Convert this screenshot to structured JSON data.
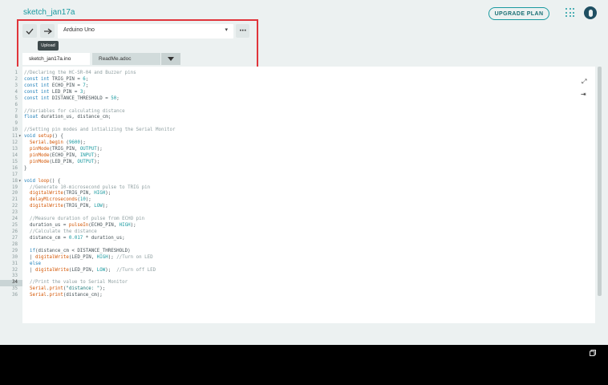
{
  "header": {
    "sketch_title": "sketch_jan17a",
    "upgrade_label": "UPGRADE PLAN"
  },
  "toolbar": {
    "board_label": "Arduino Uno",
    "tooltip": "Upload"
  },
  "tabs": [
    {
      "label": "sketch_jan17a.ino"
    },
    {
      "label": "ReadMe.adoc"
    }
  ],
  "editor": {
    "active_line": 34,
    "lines": [
      {
        "n": "1",
        "fold": "",
        "segs": [
          [
            "c",
            "//Declaring the HC-SR-04 and Buzzer pins"
          ]
        ]
      },
      {
        "n": "2",
        "fold": "",
        "segs": [
          [
            "k",
            "const int "
          ],
          [
            "p",
            "TRIG_PIN = "
          ],
          [
            "n",
            "6"
          ],
          [
            "p",
            ";"
          ]
        ]
      },
      {
        "n": "3",
        "fold": "",
        "segs": [
          [
            "k",
            "const int "
          ],
          [
            "p",
            "ECHO_PIN = "
          ],
          [
            "n",
            "7"
          ],
          [
            "p",
            ";"
          ]
        ]
      },
      {
        "n": "4",
        "fold": "",
        "segs": [
          [
            "k",
            "const int "
          ],
          [
            "p",
            "LED_PIN = "
          ],
          [
            "n",
            "3"
          ],
          [
            "p",
            ";"
          ]
        ]
      },
      {
        "n": "5",
        "fold": "",
        "segs": [
          [
            "k",
            "const int "
          ],
          [
            "p",
            "DISTANCE_THRESHOLD = "
          ],
          [
            "n",
            "50"
          ],
          [
            "p",
            ";"
          ]
        ]
      },
      {
        "n": "6",
        "fold": "",
        "segs": []
      },
      {
        "n": "7",
        "fold": "",
        "segs": [
          [
            "c",
            "//Variables for calculating distance"
          ]
        ]
      },
      {
        "n": "8",
        "fold": "",
        "segs": [
          [
            "k",
            "float "
          ],
          [
            "p",
            "duration_us, distance_cm;"
          ]
        ]
      },
      {
        "n": "9",
        "fold": "",
        "segs": []
      },
      {
        "n": "10",
        "fold": "",
        "segs": [
          [
            "c",
            "//Setting pin modes and intializing the Serial Monitor"
          ]
        ]
      },
      {
        "n": "11",
        "fold": "▾",
        "segs": [
          [
            "k",
            "void "
          ],
          [
            "f",
            "setup"
          ],
          [
            "p",
            "() {"
          ]
        ]
      },
      {
        "n": "12",
        "fold": "",
        "segs": [
          [
            "p",
            "  "
          ],
          [
            "f",
            "Serial"
          ],
          [
            "p",
            "."
          ],
          [
            "f",
            "begin"
          ],
          [
            "p",
            " ("
          ],
          [
            "n",
            "9600"
          ],
          [
            "p",
            ");"
          ]
        ]
      },
      {
        "n": "13",
        "fold": "",
        "segs": [
          [
            "p",
            "  "
          ],
          [
            "f",
            "pinMode"
          ],
          [
            "p",
            "(TRIG_PIN, "
          ],
          [
            "n",
            "OUTPUT"
          ],
          [
            "p",
            ");"
          ]
        ]
      },
      {
        "n": "14",
        "fold": "",
        "segs": [
          [
            "p",
            "  "
          ],
          [
            "f",
            "pinMode"
          ],
          [
            "p",
            "(ECHO_PIN, "
          ],
          [
            "n",
            "INPUT"
          ],
          [
            "p",
            ");"
          ]
        ]
      },
      {
        "n": "15",
        "fold": "",
        "segs": [
          [
            "p",
            "  "
          ],
          [
            "f",
            "pinMode"
          ],
          [
            "p",
            "(LED_PIN, "
          ],
          [
            "n",
            "OUTPUT"
          ],
          [
            "p",
            ");"
          ]
        ]
      },
      {
        "n": "16",
        "fold": "",
        "segs": [
          [
            "p",
            "}"
          ]
        ]
      },
      {
        "n": "17",
        "fold": "",
        "segs": []
      },
      {
        "n": "18",
        "fold": "▾",
        "segs": [
          [
            "k",
            "void "
          ],
          [
            "f",
            "loop"
          ],
          [
            "p",
            "() {"
          ]
        ]
      },
      {
        "n": "19",
        "fold": "",
        "segs": [
          [
            "p",
            "  "
          ],
          [
            "c",
            "//Generate 10-microsecond pulse to TRIG pin"
          ]
        ]
      },
      {
        "n": "20",
        "fold": "",
        "segs": [
          [
            "p",
            "  "
          ],
          [
            "f",
            "digitalWrite"
          ],
          [
            "p",
            "(TRIG_PIN, "
          ],
          [
            "n",
            "HIGH"
          ],
          [
            "p",
            ");"
          ]
        ]
      },
      {
        "n": "21",
        "fold": "",
        "segs": [
          [
            "p",
            "  "
          ],
          [
            "f",
            "delayMicroseconds"
          ],
          [
            "p",
            "("
          ],
          [
            "n",
            "10"
          ],
          [
            "p",
            ");"
          ]
        ]
      },
      {
        "n": "22",
        "fold": "",
        "segs": [
          [
            "p",
            "  "
          ],
          [
            "f",
            "digitalWrite"
          ],
          [
            "p",
            "(TRIG_PIN, "
          ],
          [
            "n",
            "LOW"
          ],
          [
            "p",
            ");"
          ]
        ]
      },
      {
        "n": "23",
        "fold": "",
        "segs": []
      },
      {
        "n": "24",
        "fold": "",
        "segs": [
          [
            "p",
            "  "
          ],
          [
            "c",
            "//Measure duration of pulse from ECHO pin"
          ]
        ]
      },
      {
        "n": "25",
        "fold": "",
        "segs": [
          [
            "p",
            "  duration_us = "
          ],
          [
            "f",
            "pulseIn"
          ],
          [
            "p",
            "(ECHO_PIN, "
          ],
          [
            "n",
            "HIGH"
          ],
          [
            "p",
            ");"
          ]
        ]
      },
      {
        "n": "26",
        "fold": "",
        "segs": [
          [
            "p",
            "  "
          ],
          [
            "c",
            "//Calculate the distance"
          ]
        ]
      },
      {
        "n": "27",
        "fold": "",
        "segs": [
          [
            "p",
            "  distance_cm = "
          ],
          [
            "n",
            "0.017"
          ],
          [
            "p",
            " * duration_us;"
          ]
        ]
      },
      {
        "n": "28",
        "fold": "",
        "segs": []
      },
      {
        "n": "29",
        "fold": "",
        "segs": [
          [
            "p",
            "  "
          ],
          [
            "k",
            "if"
          ],
          [
            "p",
            "(distance_cm < DISTANCE_THRESHOLD)"
          ]
        ]
      },
      {
        "n": "30",
        "fold": "",
        "segs": [
          [
            "p",
            "  | "
          ],
          [
            "f",
            "digitalWrite"
          ],
          [
            "p",
            "(LED_PIN, "
          ],
          [
            "n",
            "HIGH"
          ],
          [
            "p",
            "); "
          ],
          [
            "c",
            "//Turn on LED"
          ]
        ]
      },
      {
        "n": "31",
        "fold": "",
        "segs": [
          [
            "p",
            "  "
          ],
          [
            "k",
            "else"
          ]
        ]
      },
      {
        "n": "32",
        "fold": "",
        "segs": [
          [
            "p",
            "  | "
          ],
          [
            "f",
            "digitalWrite"
          ],
          [
            "p",
            "(LED_PIN, "
          ],
          [
            "n",
            "LOW"
          ],
          [
            "p",
            ");  "
          ],
          [
            "c",
            "//Turn off LED"
          ]
        ]
      },
      {
        "n": "33",
        "fold": "",
        "segs": []
      },
      {
        "n": "34",
        "fold": "",
        "segs": [
          [
            "p",
            "  "
          ],
          [
            "c",
            "//Print the value to Serial Monitor"
          ]
        ]
      },
      {
        "n": "35",
        "fold": "",
        "segs": [
          [
            "p",
            "  "
          ],
          [
            "f",
            "Serial"
          ],
          [
            "p",
            "."
          ],
          [
            "f",
            "print"
          ],
          [
            "p",
            "("
          ],
          [
            "s",
            "\"distance: \""
          ],
          [
            "p",
            ");"
          ]
        ]
      },
      {
        "n": "36",
        "fold": "",
        "segs": [
          [
            "p",
            "  "
          ],
          [
            "f",
            "Serial"
          ],
          [
            "p",
            "."
          ],
          [
            "f",
            "print"
          ],
          [
            "p",
            "(distance_cm);"
          ]
        ]
      }
    ]
  },
  "icons": {
    "verify": "checkmark-icon",
    "upload": "arrow-right-icon",
    "board_dropdown": "chevron-down-icon",
    "more": "ellipsis-icon",
    "tab_menu": "triangle-down-icon",
    "apps": "grid-icon",
    "avatar": "user-avatar-icon",
    "expand": "expand-icon",
    "indent": "indent-icon",
    "console_copy": "copy-icon"
  },
  "colors": {
    "accent": "#1a9aa0",
    "highlight_box": "#e0353b",
    "console_bg": "#000000"
  }
}
